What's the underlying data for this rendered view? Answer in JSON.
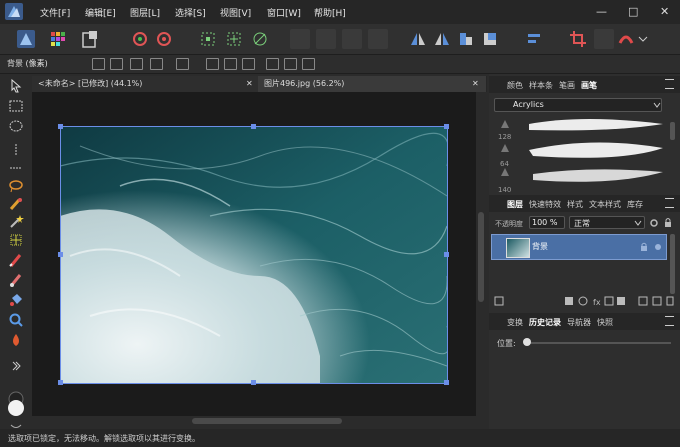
{
  "menubar": {
    "items": [
      "文件[F]",
      "编辑[E]",
      "图层[L]",
      "选择[S]",
      "视图[V]",
      "窗口[W]",
      "帮助[H]"
    ],
    "window_controls": [
      "—",
      "□",
      "✕"
    ]
  },
  "context_bar": {
    "layer_label": "背景 (像素)"
  },
  "document_tabs": [
    {
      "title": "<未命名> [已修改] (44.1%)",
      "close": "✕"
    },
    {
      "title": "图片496.jpg (56.2%)",
      "close": "✕"
    }
  ],
  "brush_panel": {
    "tabs": [
      "颜色",
      "样本条",
      "笔画",
      "画笔"
    ],
    "active_tab": "画笔",
    "category": "Acrylics",
    "sizes": [
      "128",
      "64",
      "140"
    ]
  },
  "layers_panel": {
    "tabs": [
      "图层",
      "快速特效",
      "样式",
      "文本样式",
      "库存"
    ],
    "active_tab": "图层",
    "opacity_label": "不透明度",
    "opacity_value": "100 %",
    "blend_mode": "正常",
    "layers": [
      {
        "name": "背景",
        "selected": true
      }
    ]
  },
  "history_panel": {
    "tabs": [
      "变换",
      "历史记录",
      "导航器",
      "快照"
    ],
    "active_tab": "历史记录",
    "position_label": "位置:"
  },
  "status_bar": {
    "message": "选取项已锁定，无法移动。解锁选取项以其进行变换。"
  },
  "colors": {
    "accent": "#4a6fa5",
    "selection": "#6b8ee8",
    "background": "#2b2b2b"
  }
}
